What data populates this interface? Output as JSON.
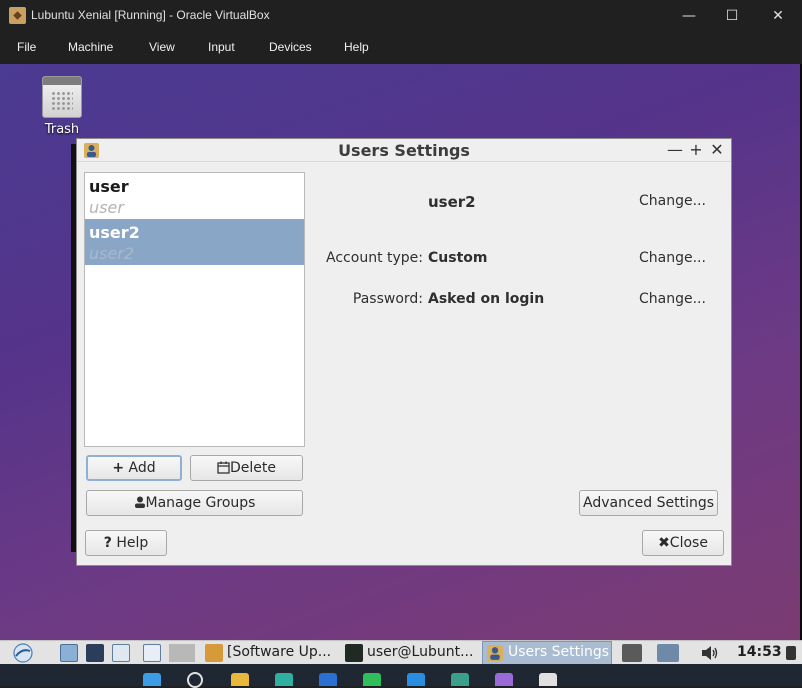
{
  "window": {
    "title": "Lubuntu Xenial [Running] - Oracle VirtualBox",
    "minimize_symbol": "—",
    "maximize_symbol": "☐",
    "close_symbol": "✕"
  },
  "menubar": {
    "items": [
      "File",
      "Machine",
      "View",
      "Input",
      "Devices",
      "Help"
    ]
  },
  "desktop": {
    "trash_label": "Trash"
  },
  "dialog": {
    "title": "Users Settings",
    "minimize_symbol": "—",
    "maximize_symbol": "+",
    "close_symbol": "✕",
    "users": [
      {
        "name": "user",
        "full_name": "user",
        "selected": false
      },
      {
        "name": "user2",
        "full_name": "user2",
        "selected": true
      }
    ],
    "details": {
      "selected_name": "user2",
      "name_change": "Change...",
      "account_type_label": "Account type:",
      "account_type_value": "Custom",
      "account_type_change": "Change...",
      "password_label": "Password:",
      "password_value": "Asked on login",
      "password_change": "Change..."
    },
    "buttons": {
      "add": "Add",
      "add_icon": "+",
      "delete": "Delete",
      "manage_groups": "Manage Groups",
      "advanced_settings": "Advanced Settings",
      "help": "Help",
      "help_icon": "?",
      "close": "Close",
      "close_icon": "✖"
    }
  },
  "taskbar": {
    "items": [
      {
        "label": "[Software Up..."
      },
      {
        "label": "user@Lubunt..."
      },
      {
        "label": "Users Settings"
      }
    ],
    "clock": "14:53"
  },
  "colors": {
    "desktop_gradient_start": "#4b3b92",
    "desktop_gradient_end": "#7b3b72",
    "selection": "#8aa6c6",
    "host_chrome": "#202020"
  }
}
